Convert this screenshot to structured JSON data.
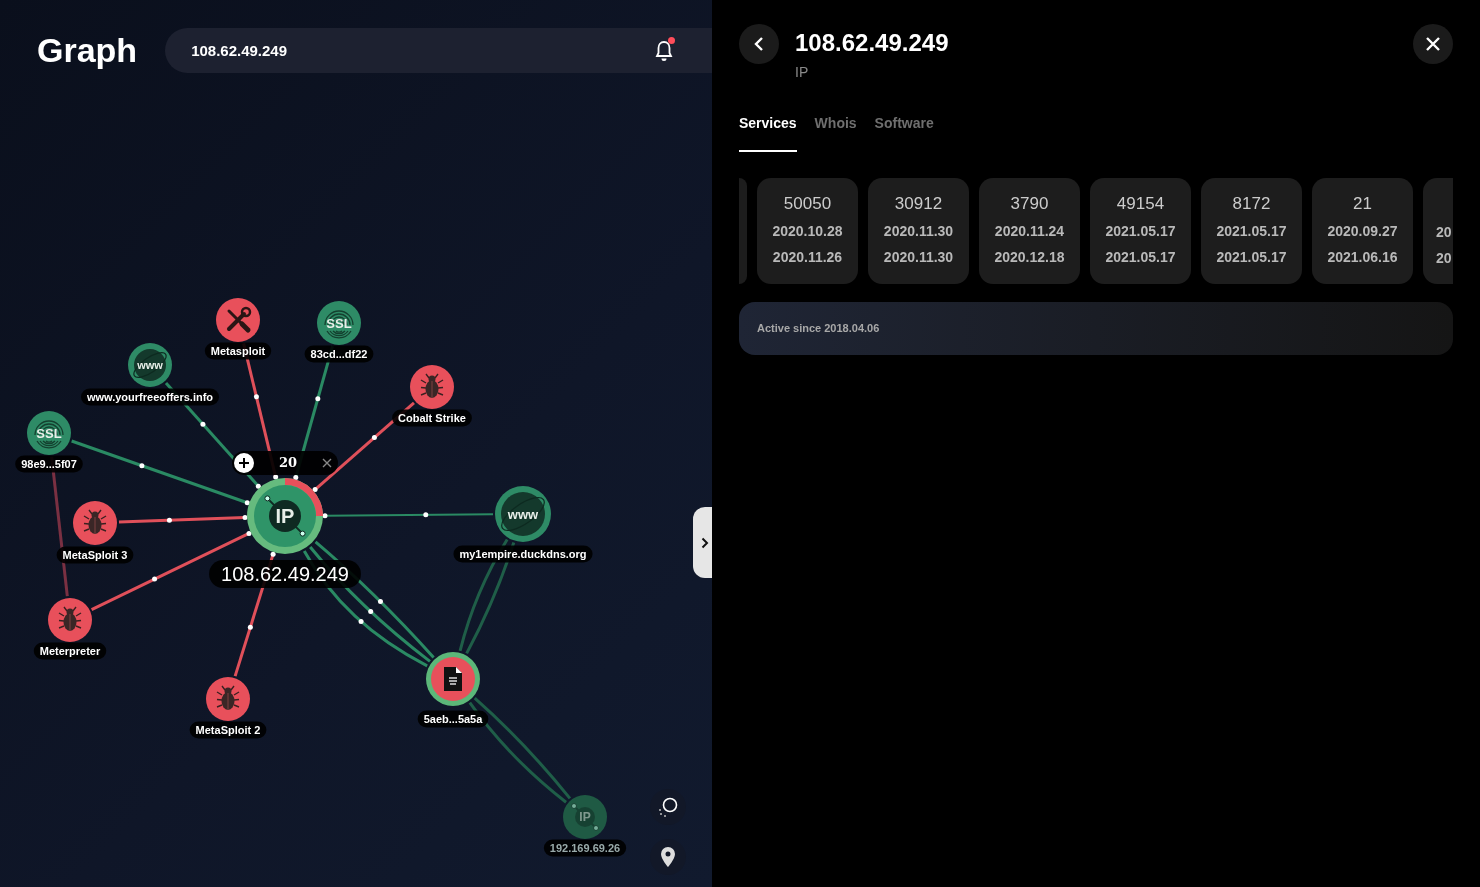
{
  "header": {
    "title": "Graph",
    "search": {
      "value": "108.62.49.249"
    },
    "notifications": {
      "unread": true
    }
  },
  "graph": {
    "nodes": [
      {
        "kind": "ip",
        "glyph": "IP",
        "label": "108.62.49.249",
        "color": "#2f9468",
        "selected": true,
        "dimmed": false
      },
      {
        "kind": "tool",
        "label": "Metasploit",
        "color": "#e8505b",
        "selected": false,
        "dimmed": false
      },
      {
        "kind": "ssl",
        "glyph": "SSL",
        "label": "83cd...df22",
        "color": "#2e8b66",
        "selected": false,
        "dimmed": false
      },
      {
        "kind": "www",
        "glyph": "www",
        "label": "www.yourfreeoffers.info",
        "color": "#2e8b66",
        "selected": false,
        "dimmed": false
      },
      {
        "kind": "bug",
        "label": "Cobalt Strike",
        "color": "#e8505b",
        "selected": false,
        "dimmed": false
      },
      {
        "kind": "ssl",
        "glyph": "SSL",
        "label": "98e9...5f07",
        "color": "#2e8b66",
        "selected": false,
        "dimmed": false
      },
      {
        "kind": "bug",
        "label": "MetaSploit 3",
        "color": "#e8505b",
        "selected": false,
        "dimmed": false
      },
      {
        "kind": "www",
        "glyph": "www",
        "label": "my1empire.duckdns.org",
        "color": "#2e8b66",
        "selected": false,
        "dimmed": false
      },
      {
        "kind": "bug",
        "label": "Meterpreter",
        "color": "#e8505b",
        "selected": false,
        "dimmed": false
      },
      {
        "kind": "bug",
        "label": "MetaSploit 2",
        "color": "#e8505b",
        "selected": false,
        "dimmed": false
      },
      {
        "kind": "file",
        "label": "5aeb...5a5a",
        "color": "#e8505b",
        "selected": false,
        "dimmed": false
      },
      {
        "kind": "ip",
        "glyph": "IP",
        "label": "192.169.69.26",
        "color": "#1f5a44",
        "selected": false,
        "dimmed": true
      }
    ],
    "cluster": {
      "count": "20"
    }
  },
  "panel": {
    "title": "108.62.49.249",
    "subtitle": "IP",
    "tabs": [
      {
        "label": "Services",
        "selected": true
      },
      {
        "label": "Whois",
        "selected": false
      },
      {
        "label": "Software",
        "selected": false
      }
    ],
    "services": [
      {
        "kind": "sliver"
      },
      {
        "kind": "card",
        "port": "50050",
        "first_seen": "2020.10.28",
        "last_seen": "2020.11.26"
      },
      {
        "kind": "card",
        "port": "30912",
        "first_seen": "2020.11.30",
        "last_seen": "2020.11.30"
      },
      {
        "kind": "card",
        "port": "3790",
        "first_seen": "2020.11.24",
        "last_seen": "2020.12.18"
      },
      {
        "kind": "card",
        "port": "49154",
        "first_seen": "2021.05.17",
        "last_seen": "2021.05.17"
      },
      {
        "kind": "card",
        "port": "8172",
        "first_seen": "2021.05.17",
        "last_seen": "2021.05.17"
      },
      {
        "kind": "card",
        "port": "21",
        "first_seen": "2020.09.27",
        "last_seen": "2021.06.16"
      },
      {
        "kind": "partial",
        "first_seen": "20",
        "last_seen": "20"
      }
    ],
    "active_since": "Active since 2018.04.06"
  }
}
